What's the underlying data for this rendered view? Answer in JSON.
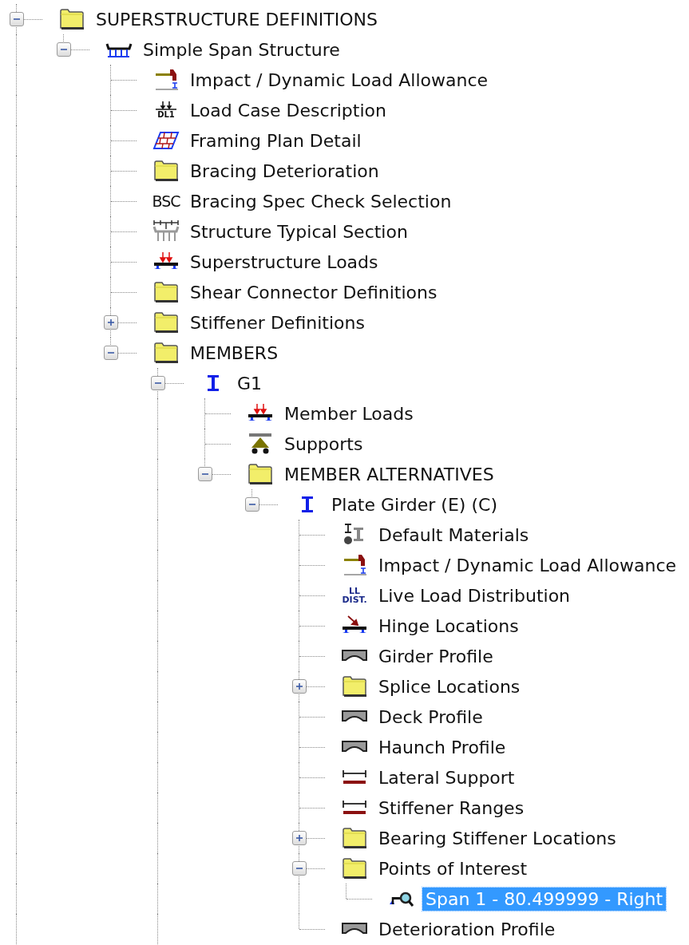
{
  "tree": [
    {
      "label": "SUPERSTRUCTURE DEFINITIONS",
      "kind": "folder",
      "expanded": true,
      "selected": false,
      "more_above": true,
      "more_below": true,
      "children": [
        {
          "label": "Simple Span Structure",
          "kind": "bridge",
          "expanded": true,
          "selected": false,
          "children": [
            {
              "label": "Impact / Dynamic Load Allowance",
              "kind": "impact",
              "selected": false
            },
            {
              "label": "Load Case Description",
              "kind": "loadcase",
              "icon_text": [
                "DL1"
              ],
              "selected": false
            },
            {
              "label": "Framing Plan Detail",
              "kind": "framing",
              "selected": false
            },
            {
              "label": "Bracing Deterioration",
              "kind": "folder",
              "selected": false
            },
            {
              "label": "Bracing Spec Check Selection",
              "kind": "textmark",
              "icon_text": [
                "BSC"
              ],
              "selected": false
            },
            {
              "label": "Structure Typical Section",
              "kind": "section",
              "selected": false
            },
            {
              "label": "Superstructure Loads",
              "kind": "loads",
              "selected": false
            },
            {
              "label": "Shear Connector Definitions",
              "kind": "folder",
              "selected": false
            },
            {
              "label": "Stiffener Definitions",
              "kind": "folder",
              "expanded": false,
              "selected": false
            },
            {
              "label": "MEMBERS",
              "kind": "folder",
              "expanded": true,
              "selected": false,
              "children": [
                {
                  "label": "G1",
                  "kind": "ibeam",
                  "expanded": true,
                  "selected": false,
                  "more_below": true,
                  "children": [
                    {
                      "label": "Member Loads",
                      "kind": "loads",
                      "selected": false
                    },
                    {
                      "label": "Supports",
                      "kind": "supports",
                      "selected": false
                    },
                    {
                      "label": "MEMBER ALTERNATIVES",
                      "kind": "folder",
                      "expanded": true,
                      "selected": false,
                      "children": [
                        {
                          "label": "Plate Girder (E) (C)",
                          "kind": "ibeam",
                          "expanded": true,
                          "selected": false,
                          "children": [
                            {
                              "label": "Default Materials",
                              "kind": "materials",
                              "selected": false
                            },
                            {
                              "label": "Impact / Dynamic Load Allowance",
                              "kind": "impact",
                              "selected": false
                            },
                            {
                              "label": "Live Load Distribution",
                              "kind": "textmark",
                              "icon_text": [
                                "LL",
                                "DIST."
                              ],
                              "selected": false
                            },
                            {
                              "label": "Hinge Locations",
                              "kind": "hinge",
                              "selected": false
                            },
                            {
                              "label": "Girder Profile",
                              "kind": "profile",
                              "selected": false
                            },
                            {
                              "label": "Splice Locations",
                              "kind": "folder",
                              "expanded": false,
                              "selected": false
                            },
                            {
                              "label": "Deck Profile",
                              "kind": "profile",
                              "selected": false
                            },
                            {
                              "label": "Haunch Profile",
                              "kind": "profile",
                              "selected": false
                            },
                            {
                              "label": "Lateral Support",
                              "kind": "range",
                              "selected": false
                            },
                            {
                              "label": "Stiffener Ranges",
                              "kind": "range",
                              "selected": false
                            },
                            {
                              "label": "Bearing Stiffener Locations",
                              "kind": "folder",
                              "expanded": false,
                              "selected": false
                            },
                            {
                              "label": "Points of Interest",
                              "kind": "folder",
                              "expanded": true,
                              "selected": false,
                              "children": [
                                {
                                  "label": "Span 1 - 80.499999 - Right",
                                  "kind": "poi",
                                  "selected": true
                                }
                              ]
                            },
                            {
                              "label": "Deterioration Profile",
                              "kind": "profile",
                              "selected": false
                            }
                          ]
                        }
                      ]
                    }
                  ]
                }
              ]
            }
          ]
        }
      ]
    }
  ]
}
